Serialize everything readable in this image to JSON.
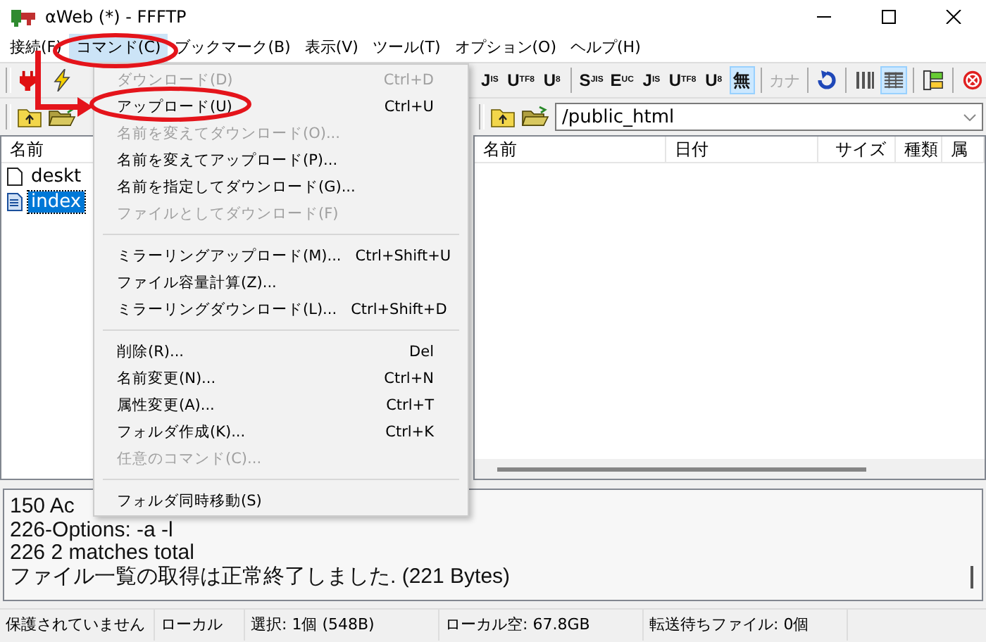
{
  "window": {
    "title": "αWeb (*) - FFFTP"
  },
  "menu_bar": [
    {
      "label": "接続(F)",
      "selected": false
    },
    {
      "label": "コマンド(C)",
      "selected": true
    },
    {
      "label": "ブックマーク(B)",
      "selected": false
    },
    {
      "label": "表示(V)",
      "selected": false
    },
    {
      "label": "ツール(T)",
      "selected": false
    },
    {
      "label": "オプション(O)",
      "selected": false
    },
    {
      "label": "ヘルプ(H)",
      "selected": false
    }
  ],
  "toolbar": [
    {
      "kind": "plug"
    },
    {
      "kind": "lightning"
    },
    {
      "kind": "gap"
    },
    {
      "kind": "code",
      "main": "J",
      "sub": "IS",
      "selected": false
    },
    {
      "kind": "code",
      "main": "U",
      "sub": "TF8",
      "selected": false
    },
    {
      "kind": "code",
      "main": "U",
      "sub": "8",
      "selected": false
    },
    {
      "kind": "sep"
    },
    {
      "kind": "code",
      "main": "S",
      "sub": "JIS",
      "selected": false
    },
    {
      "kind": "code",
      "main": "E",
      "sub": "UC",
      "selected": false
    },
    {
      "kind": "code",
      "main": "J",
      "sub": "IS",
      "selected": false
    },
    {
      "kind": "code",
      "main": "U",
      "sub": "TF8",
      "selected": false
    },
    {
      "kind": "code",
      "main": "U",
      "sub": "8",
      "selected": false
    },
    {
      "kind": "code",
      "main": "無",
      "selected": true
    },
    {
      "kind": "sep"
    },
    {
      "kind": "kana",
      "main": "カナ",
      "disabled": true
    },
    {
      "kind": "sep"
    },
    {
      "kind": "refresh"
    },
    {
      "kind": "sep"
    },
    {
      "kind": "list",
      "selected": false
    },
    {
      "kind": "details",
      "selected": true
    },
    {
      "kind": "sep"
    },
    {
      "kind": "sync"
    },
    {
      "kind": "sep"
    },
    {
      "kind": "stop"
    }
  ],
  "local": {
    "column": "名前",
    "files": [
      {
        "name": "deskt",
        "kind": "file",
        "selected": false
      },
      {
        "name": "index",
        "kind": "html",
        "selected": true
      }
    ]
  },
  "remote": {
    "path": "/public_html",
    "columns": [
      "名前",
      "日付",
      "サイズ",
      "種類",
      "属"
    ]
  },
  "command_menu": [
    {
      "kind": "item",
      "label": "ダウンロード(D)",
      "shortcut": "Ctrl+D",
      "disabled": true
    },
    {
      "kind": "item",
      "label": "アップロード(U)",
      "shortcut": "Ctrl+U",
      "disabled": false
    },
    {
      "kind": "item",
      "label": "名前を変えてダウンロード(O)...",
      "disabled": true
    },
    {
      "kind": "item",
      "label": "名前を変えてアップロード(P)...",
      "disabled": false
    },
    {
      "kind": "item",
      "label": "名前を指定してダウンロード(G)...",
      "disabled": false
    },
    {
      "kind": "item",
      "label": "ファイルとしてダウンロード(F)",
      "disabled": true
    },
    {
      "kind": "separator"
    },
    {
      "kind": "item",
      "label": "ミラーリングアップロード(M)...",
      "shortcut": "Ctrl+Shift+U",
      "disabled": false
    },
    {
      "kind": "item",
      "label": "ファイル容量計算(Z)...",
      "disabled": false
    },
    {
      "kind": "item",
      "label": "ミラーリングダウンロード(L)...",
      "shortcut": "Ctrl+Shift+D",
      "disabled": false
    },
    {
      "kind": "separator"
    },
    {
      "kind": "item",
      "label": "削除(R)...",
      "shortcut": "Del",
      "disabled": false
    },
    {
      "kind": "item",
      "label": "名前変更(N)...",
      "shortcut": "Ctrl+N",
      "disabled": false
    },
    {
      "kind": "item",
      "label": "属性変更(A)...",
      "shortcut": "Ctrl+T",
      "disabled": false
    },
    {
      "kind": "item",
      "label": "フォルダ作成(K)...",
      "shortcut": "Ctrl+K",
      "disabled": false
    },
    {
      "kind": "item",
      "label": "任意のコマンド(C)...",
      "disabled": true
    },
    {
      "kind": "separator"
    },
    {
      "kind": "item",
      "label": "フォルダ同時移動(S)",
      "disabled": false
    }
  ],
  "log": [
    "150 Ac",
    "226-Options: -a -l",
    "226 2 matches total",
    "ファイル一覧の取得は正常終了しました. (221 Bytes)"
  ],
  "status_bar": [
    "保護されていません",
    "ローカル",
    "選択: 1個 (548B)",
    "ローカル空: 67.8GB",
    "転送待ちファイル: 0個"
  ]
}
